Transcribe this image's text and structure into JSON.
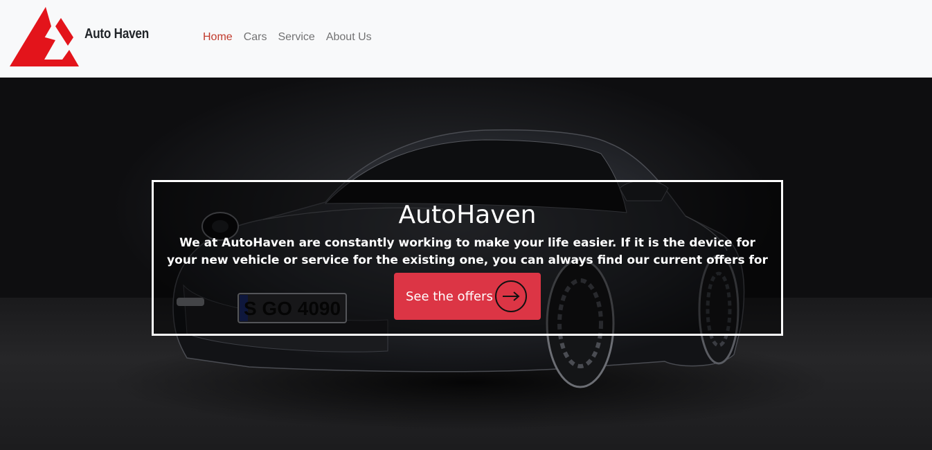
{
  "brand": {
    "name": "Auto Haven",
    "logo_icon": "autohaven-logo-icon",
    "accent_color": "#e3141b"
  },
  "nav": {
    "items": [
      {
        "label": "Home",
        "active": true
      },
      {
        "label": "Cars",
        "active": false
      },
      {
        "label": "Service",
        "active": false
      },
      {
        "label": "About Us",
        "active": false
      }
    ],
    "active_color": "#c0392b"
  },
  "hero": {
    "title": "AutoHaven",
    "text": "We at AutoHaven are constantly working to make your life easier. If it is the device for your new vehicle or service for the existing one, you can always find our current offers for you.",
    "cta_label": "See the offers",
    "cta_icon": "arrow-right-circle-icon",
    "cta_color": "#dc3545",
    "background_image": "dark-sports-car-image",
    "license_plate": "S GO 4090"
  }
}
